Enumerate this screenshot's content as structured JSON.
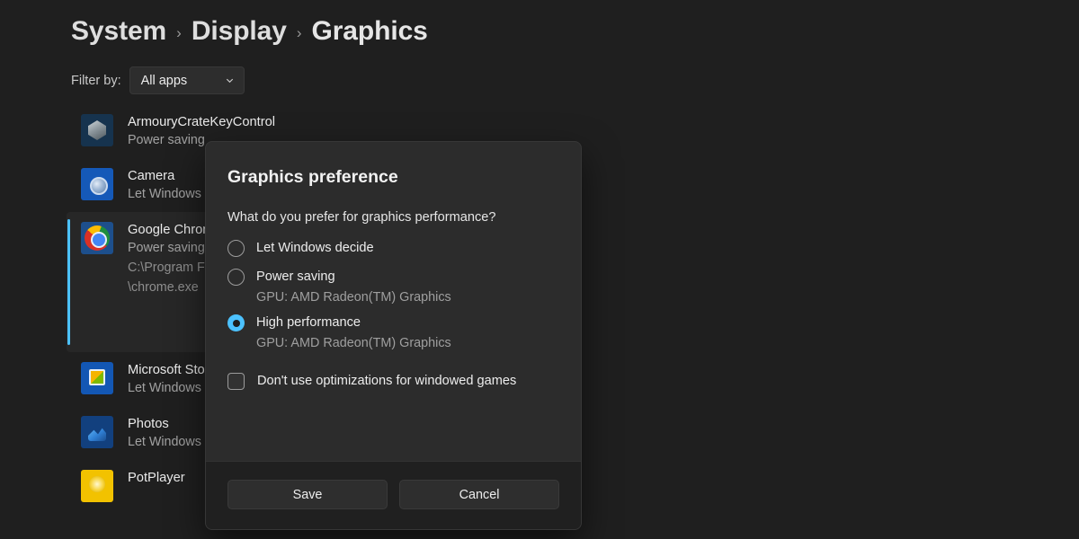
{
  "breadcrumb": {
    "items": [
      "System",
      "Display",
      "Graphics"
    ],
    "separator": "›"
  },
  "filter": {
    "label": "Filter by:",
    "value": "All apps",
    "icon": "chevron-down-icon"
  },
  "app_list": [
    {
      "name": "ArmouryCrateKeyControl",
      "preference": "Power saving",
      "path": "",
      "icon": "armourycrate-icon",
      "expanded": false
    },
    {
      "name": "Camera",
      "preference": "Let Windows",
      "path": "",
      "icon": "camera-icon",
      "expanded": false
    },
    {
      "name": "Google Chrom",
      "preference": "Power saving",
      "path": "C:\\Program F",
      "path2": "\\chrome.exe",
      "icon": "chrome-icon",
      "expanded": true
    },
    {
      "name": "Microsoft Sto",
      "preference": "Let Windows",
      "path": "",
      "icon": "microsoft-store-icon",
      "expanded": false
    },
    {
      "name": "Photos",
      "preference": "Let Windows",
      "path": "",
      "icon": "photos-icon",
      "expanded": false
    },
    {
      "name": "PotPlayer",
      "preference": "",
      "path": "",
      "icon": "potplayer-icon",
      "expanded": false
    }
  ],
  "dialog": {
    "title": "Graphics preference",
    "question": "What do you prefer for graphics performance?",
    "options": [
      {
        "label": "Let Windows decide",
        "gpu": "",
        "selected": false
      },
      {
        "label": "Power saving",
        "gpu": "GPU: AMD Radeon(TM) Graphics",
        "selected": false
      },
      {
        "label": "High performance",
        "gpu": "GPU: AMD Radeon(TM) Graphics",
        "selected": true
      }
    ],
    "checkbox": {
      "label": "Don't use optimizations for windowed games",
      "checked": false
    },
    "save_label": "Save",
    "cancel_label": "Cancel"
  },
  "colors": {
    "accent": "#4cc2ff",
    "page_bg": "#1f1f1f",
    "dialog_bg": "#2c2c2c",
    "footer_bg": "#202020",
    "text_primary": "#ededed",
    "text_secondary": "#a2a2a2"
  }
}
